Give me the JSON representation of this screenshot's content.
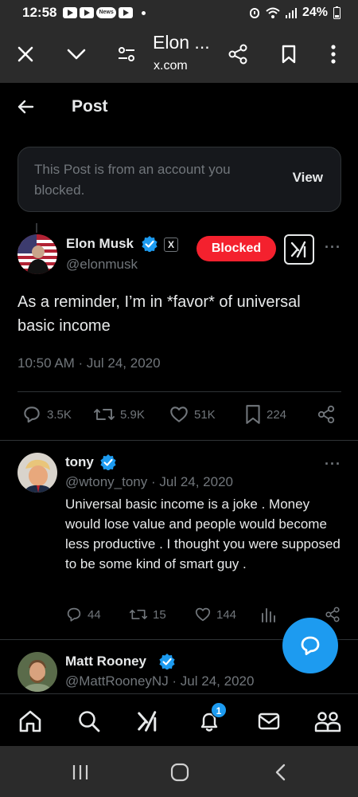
{
  "status_bar": {
    "time": "12:58",
    "news_label": "News",
    "battery": "24%"
  },
  "browser": {
    "title": "Elon ...",
    "url": "x.com"
  },
  "header": {
    "title": "Post"
  },
  "blocked_notice": {
    "text": "This Post is from an account you blocked.",
    "action": "View"
  },
  "post": {
    "author_name": "Elon Musk",
    "author_handle": "@elonmusk",
    "x_badge": "X",
    "blocked_label": "Blocked",
    "text": "As a reminder, I’m in *favor* of universal basic income",
    "timestamp": "10:50 AM · Jul 24, 2020",
    "stats": {
      "replies": "3.5K",
      "reposts": "5.9K",
      "likes": "51K",
      "bookmarks": "224"
    }
  },
  "replies": [
    {
      "name": "tony",
      "handle_date": "@wtony_tony · Jul 24, 2020",
      "text": "Universal basic income is a joke . Money would lose value and people would become less productive . I thought you were supposed to be some kind of smart guy .",
      "stats": {
        "replies": "44",
        "reposts": "15",
        "likes": "144"
      }
    },
    {
      "name": "Matt Rooney",
      "handle_date": "@MattRooneyNJ · Jul 24, 2020"
    }
  ],
  "bottom_nav": {
    "notification_count": "1"
  },
  "colors": {
    "accent": "#1d9bf0",
    "blocked": "#f4212e",
    "muted": "#71767b",
    "text": "#e7e9ea",
    "chrome": "#2b2b2b"
  },
  "icons": [
    "close-icon",
    "chevron-down-icon",
    "tune-icon",
    "share-icon",
    "bookmark-icon",
    "more-vert-icon",
    "back-arrow-icon",
    "verified-icon",
    "grok-icon",
    "reply-icon",
    "repost-icon",
    "like-icon",
    "views-icon",
    "home-icon",
    "search-icon",
    "notifications-icon",
    "messages-icon",
    "communities-icon",
    "compose-icon",
    "recents-icon",
    "home-button-icon",
    "back-icon"
  ]
}
